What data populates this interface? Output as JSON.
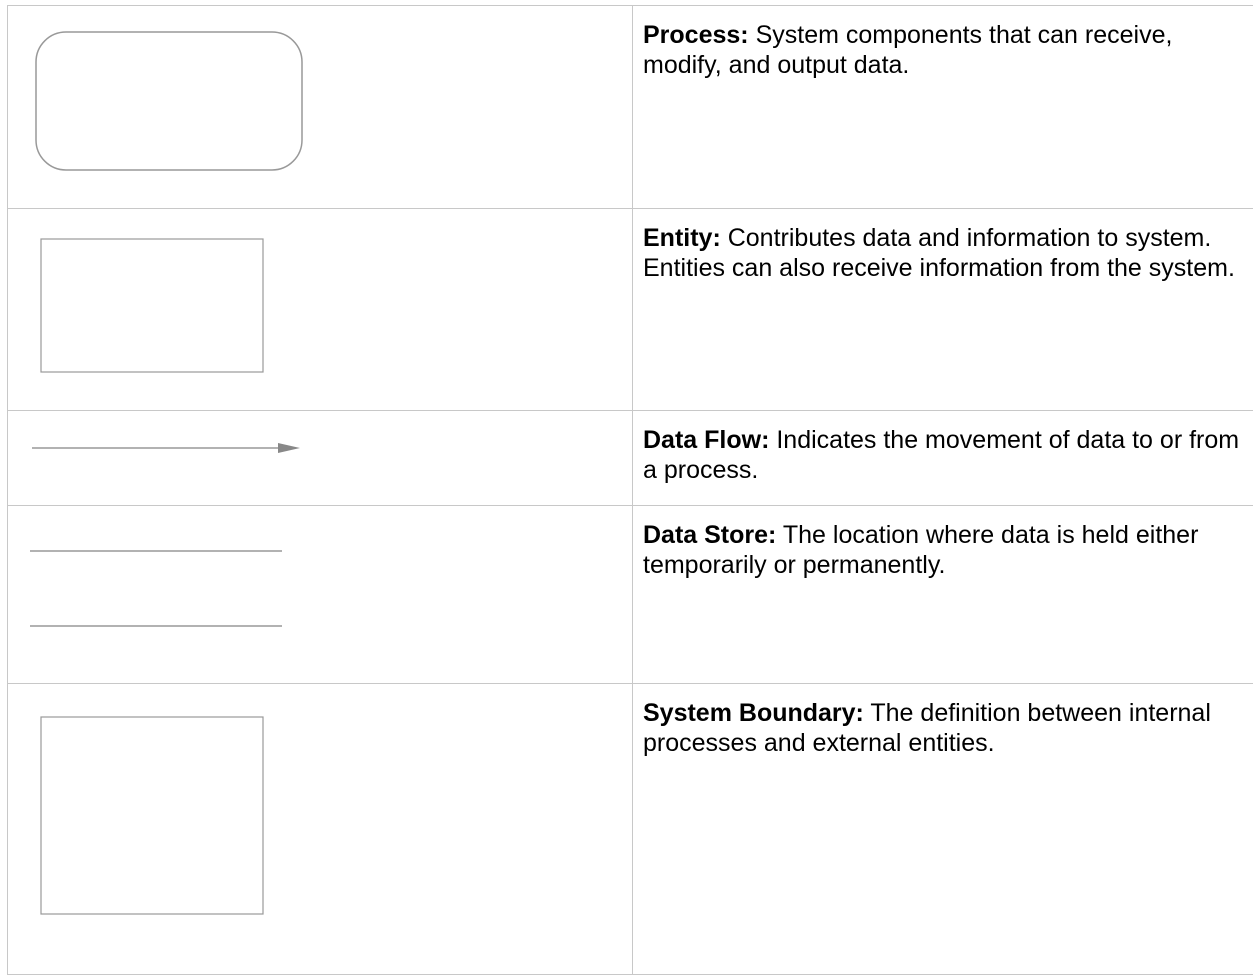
{
  "legend": {
    "rows": [
      {
        "symbol": "rounded-rectangle",
        "term": "Process:",
        "description": " System components that can receive, modify, and output data."
      },
      {
        "symbol": "rectangle",
        "term": "Entity:",
        "description": " Contributes data and information to system.  Entities can also receive information from the system."
      },
      {
        "symbol": "arrow",
        "term": "Data Flow:",
        "description": " Indicates the movement of data to or from a process."
      },
      {
        "symbol": "parallel-lines",
        "term": "Data Store:",
        "description": " The location where data is held either temporarily or permanently."
      },
      {
        "symbol": "square",
        "term": "System Boundary:",
        "description": " The definition between internal processes and external entities."
      }
    ]
  },
  "colors": {
    "grid_line": "#c8c8c8",
    "shape_stroke": "#999999",
    "text": "#000000"
  }
}
